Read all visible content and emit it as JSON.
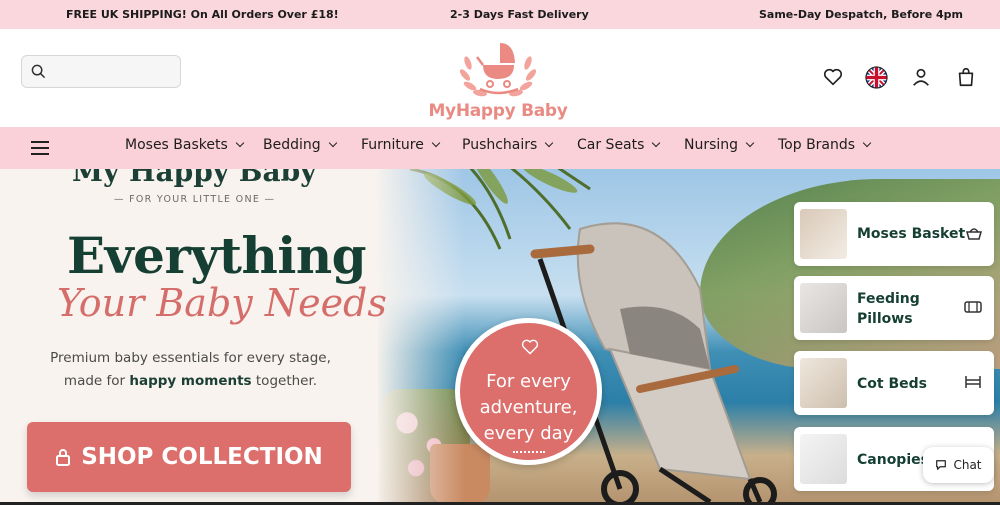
{
  "announcement": {
    "left": "FREE UK SHIPPING! On All Orders Over £18!",
    "center": "2-3 Days Fast Delivery",
    "right": "Same-Day Despatch, Before 4pm"
  },
  "header": {
    "logo_text": "MyHappy Baby",
    "icons": [
      "search-icon",
      "heart-icon",
      "uk-flag-icon",
      "user-icon",
      "bag-icon"
    ]
  },
  "nav": {
    "items": [
      {
        "label": "Moses Baskets"
      },
      {
        "label": "Bedding"
      },
      {
        "label": "Furniture"
      },
      {
        "label": "Pushchairs"
      },
      {
        "label": "Car Seats"
      },
      {
        "label": "Nursing"
      },
      {
        "label": "Top Brands"
      }
    ]
  },
  "hero": {
    "brand": "My Happy Baby",
    "tagline": "— FOR YOUR LITTLE ONE —",
    "headline": "Everything",
    "headline_script": "Your Baby Needs",
    "description_before": "Premium baby essentials for every stage, made for ",
    "description_bold": "happy moments",
    "description_after": " together.",
    "cta": "SHOP COLLECTION",
    "badge_lines": [
      "For every",
      "adventure,",
      "every day"
    ]
  },
  "categories": [
    {
      "label": "Moses Basket",
      "icon": "basket-icon"
    },
    {
      "label": "Feeding Pillows",
      "icon": "pillow-icon"
    },
    {
      "label": "Cot Beds",
      "icon": "bed-icon"
    },
    {
      "label": "Canopies",
      "icon": "canopy-icon"
    }
  ],
  "chat": {
    "label": "Chat"
  },
  "colors": {
    "accent": "#dc6f6c",
    "nav_bg": "#fbd1d9",
    "dark_green": "#163f33"
  }
}
